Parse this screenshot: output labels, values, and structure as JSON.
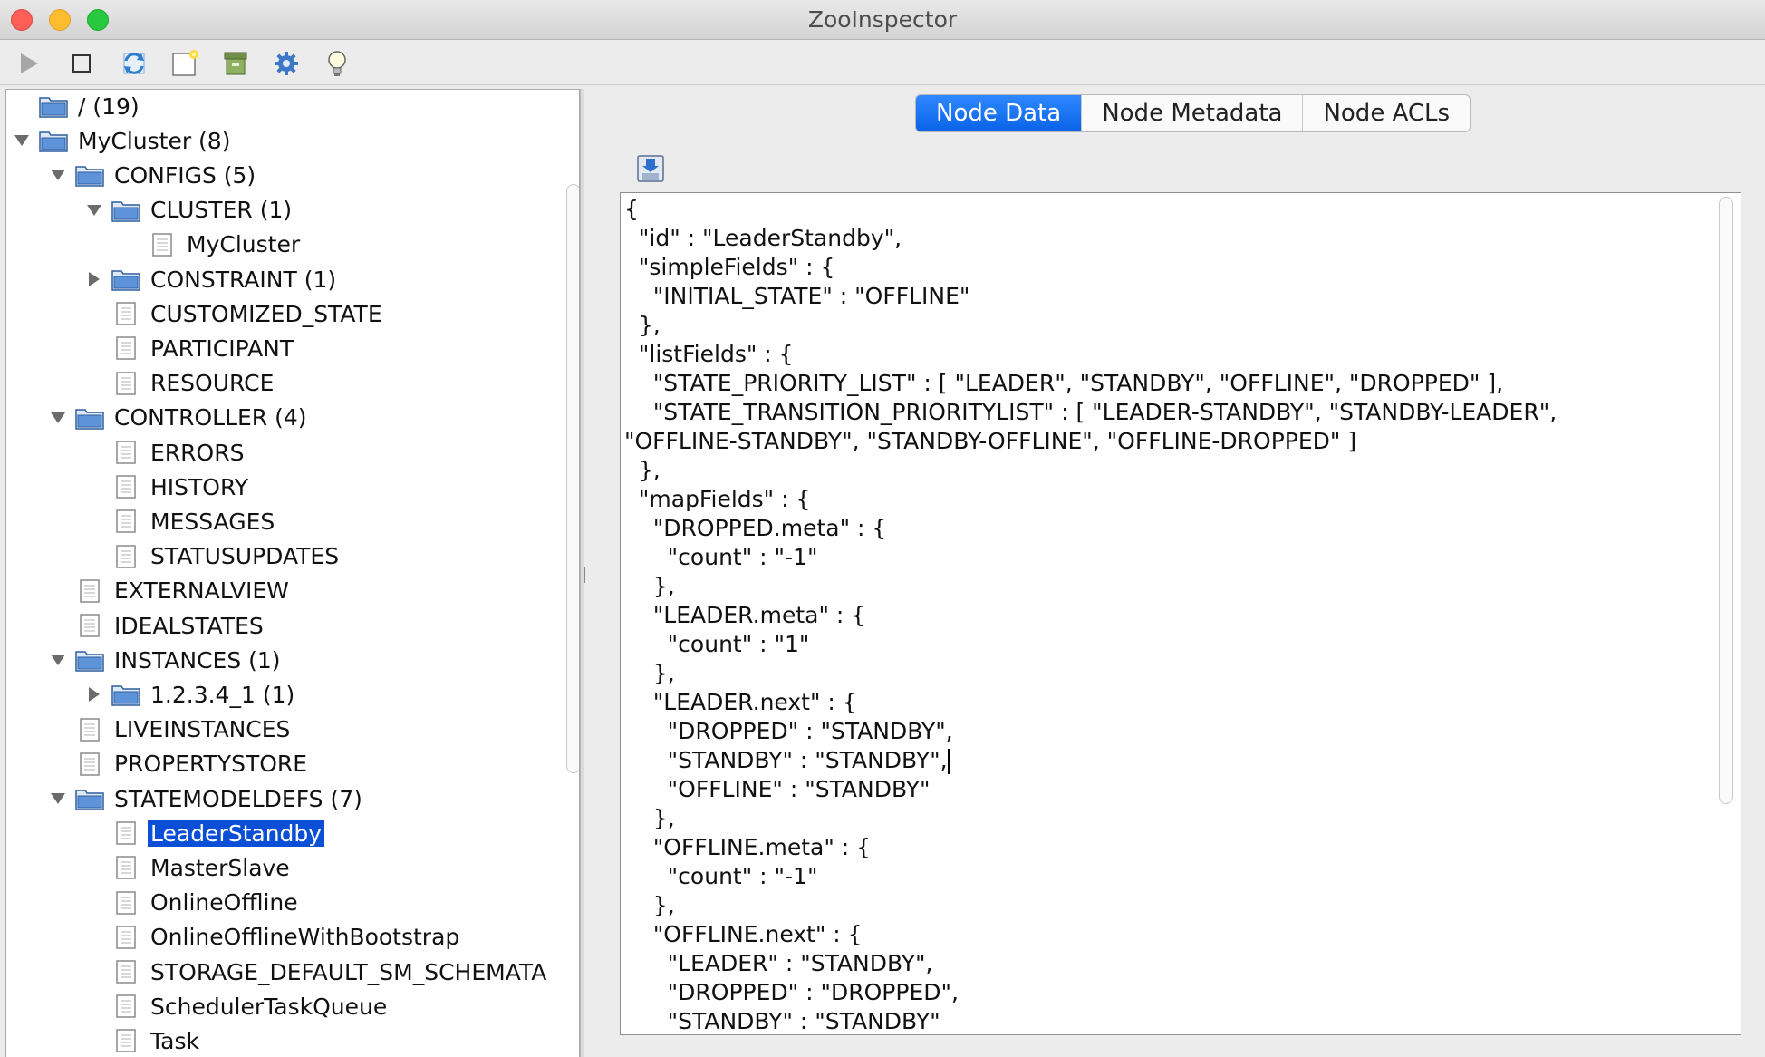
{
  "window": {
    "title": "ZooInspector"
  },
  "toolbar": {
    "buttons": [
      {
        "name": "connect-icon"
      },
      {
        "name": "disconnect-icon"
      },
      {
        "name": "refresh-icon"
      },
      {
        "name": "add-node-icon"
      },
      {
        "name": "delete-node-icon"
      },
      {
        "name": "settings-icon"
      },
      {
        "name": "about-icon"
      }
    ]
  },
  "tree": {
    "selected": "LeaderStandby",
    "nodes": [
      {
        "label": "/ (19)",
        "depth": 0,
        "type": "folder",
        "expand": "none"
      },
      {
        "label": "MyCluster (8)",
        "depth": 0,
        "type": "folder",
        "expand": "open"
      },
      {
        "label": "CONFIGS (5)",
        "depth": 1,
        "type": "folder",
        "expand": "open"
      },
      {
        "label": "CLUSTER (1)",
        "depth": 2,
        "type": "folder",
        "expand": "open"
      },
      {
        "label": "MyCluster",
        "depth": 3,
        "type": "file",
        "expand": "none"
      },
      {
        "label": "CONSTRAINT (1)",
        "depth": 2,
        "type": "folder",
        "expand": "closed"
      },
      {
        "label": "CUSTOMIZED_STATE",
        "depth": 2,
        "type": "file",
        "expand": "none"
      },
      {
        "label": "PARTICIPANT",
        "depth": 2,
        "type": "file",
        "expand": "none"
      },
      {
        "label": "RESOURCE",
        "depth": 2,
        "type": "file",
        "expand": "none"
      },
      {
        "label": "CONTROLLER (4)",
        "depth": 1,
        "type": "folder",
        "expand": "open"
      },
      {
        "label": "ERRORS",
        "depth": 2,
        "type": "file",
        "expand": "none"
      },
      {
        "label": "HISTORY",
        "depth": 2,
        "type": "file",
        "expand": "none"
      },
      {
        "label": "MESSAGES",
        "depth": 2,
        "type": "file",
        "expand": "none"
      },
      {
        "label": "STATUSUPDATES",
        "depth": 2,
        "type": "file",
        "expand": "none"
      },
      {
        "label": "EXTERNALVIEW",
        "depth": 1,
        "type": "file",
        "expand": "none"
      },
      {
        "label": "IDEALSTATES",
        "depth": 1,
        "type": "file",
        "expand": "none"
      },
      {
        "label": "INSTANCES (1)",
        "depth": 1,
        "type": "folder",
        "expand": "open"
      },
      {
        "label": "1.2.3.4_1 (1)",
        "depth": 2,
        "type": "folder",
        "expand": "closed"
      },
      {
        "label": "LIVEINSTANCES",
        "depth": 1,
        "type": "file",
        "expand": "none"
      },
      {
        "label": "PROPERTYSTORE",
        "depth": 1,
        "type": "file",
        "expand": "none"
      },
      {
        "label": "STATEMODELDEFS (7)",
        "depth": 1,
        "type": "folder",
        "expand": "open"
      },
      {
        "label": "LeaderStandby",
        "depth": 2,
        "type": "file",
        "expand": "none"
      },
      {
        "label": "MasterSlave",
        "depth": 2,
        "type": "file",
        "expand": "none"
      },
      {
        "label": "OnlineOffline",
        "depth": 2,
        "type": "file",
        "expand": "none"
      },
      {
        "label": "OnlineOfflineWithBootstrap",
        "depth": 2,
        "type": "file",
        "expand": "none"
      },
      {
        "label": "STORAGE_DEFAULT_SM_SCHEMATA",
        "depth": 2,
        "type": "file",
        "expand": "none"
      },
      {
        "label": "SchedulerTaskQueue",
        "depth": 2,
        "type": "file",
        "expand": "none"
      },
      {
        "label": "Task",
        "depth": 2,
        "type": "file",
        "expand": "none"
      }
    ]
  },
  "tabs": [
    {
      "label": "Node Data",
      "active": true
    },
    {
      "label": "Node Metadata",
      "active": false
    },
    {
      "label": "Node ACLs",
      "active": false
    }
  ],
  "editor": {
    "lines": [
      "{",
      "  \"id\" : \"LeaderStandby\",",
      "  \"simpleFields\" : {",
      "    \"INITIAL_STATE\" : \"OFFLINE\"",
      "  },",
      "  \"listFields\" : {",
      "    \"STATE_PRIORITY_LIST\" : [ \"LEADER\", \"STANDBY\", \"OFFLINE\", \"DROPPED\" ],",
      "    \"STATE_TRANSITION_PRIORITYLIST\" : [ \"LEADER-STANDBY\", \"STANDBY-LEADER\",",
      "\"OFFLINE-STANDBY\", \"STANDBY-OFFLINE\", \"OFFLINE-DROPPED\" ]",
      "  },",
      "  \"mapFields\" : {",
      "    \"DROPPED.meta\" : {",
      "      \"count\" : \"-1\"",
      "    },",
      "    \"LEADER.meta\" : {",
      "      \"count\" : \"1\"",
      "    },",
      "    \"LEADER.next\" : {",
      "      \"DROPPED\" : \"STANDBY\",",
      "      \"STANDBY\" : \"STANDBY\",",
      "      \"OFFLINE\" : \"STANDBY\"",
      "    },",
      "    \"OFFLINE.meta\" : {",
      "      \"count\" : \"-1\"",
      "    },",
      "    \"OFFLINE.next\" : {",
      "      \"LEADER\" : \"STANDBY\",",
      "      \"DROPPED\" : \"DROPPED\",",
      "      \"STANDBY\" : \"STANDBY\""
    ],
    "caret_line": 19
  }
}
